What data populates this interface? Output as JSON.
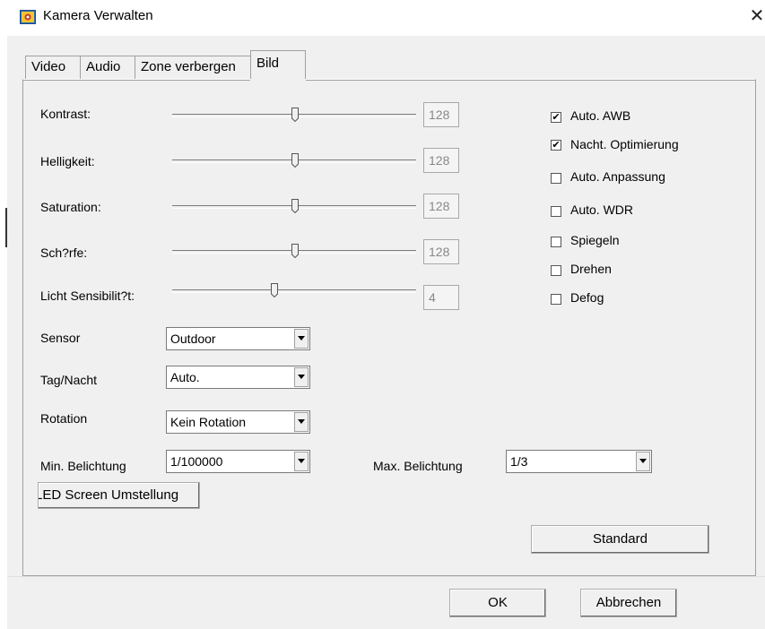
{
  "window": {
    "title": "Kamera Verwalten",
    "icon": "camera-app-icon",
    "close_glyph": "✕"
  },
  "tabs": [
    {
      "label": "Video",
      "active": false
    },
    {
      "label": "Audio",
      "active": false
    },
    {
      "label": "Zone verbergen",
      "active": false
    },
    {
      "label": "Bild",
      "active": true
    }
  ],
  "sliders": [
    {
      "label": "Kontrast:",
      "value": "128",
      "level": 128,
      "max": 255
    },
    {
      "label": "Helligkeit:",
      "value": "128",
      "level": 128,
      "max": 255
    },
    {
      "label": "Saturation:",
      "value": "128",
      "level": 128,
      "max": 255
    },
    {
      "label": "Sch?rfe:",
      "value": "128",
      "level": 128,
      "max": 255
    },
    {
      "label": "Licht Sensibilit?t:",
      "value": "4",
      "level": 4,
      "max": 8
    }
  ],
  "checkboxes": [
    {
      "label": "Auto. AWB",
      "checked": true
    },
    {
      "label": "Nacht. Optimierung",
      "checked": true
    },
    {
      "label": "Auto. Anpassung",
      "checked": false
    },
    {
      "label": "Auto. WDR",
      "checked": false
    },
    {
      "label": "Spiegeln",
      "checked": false
    },
    {
      "label": "Drehen",
      "checked": false
    },
    {
      "label": "Defog",
      "checked": false
    }
  ],
  "check_glyph": "✔",
  "selects": {
    "sensor": {
      "label": "Sensor",
      "value": "Outdoor"
    },
    "tag_nacht": {
      "label": "Tag/Nacht",
      "value": "Auto."
    },
    "rotation": {
      "label": "Rotation",
      "value": "Kein Rotation"
    },
    "min_belichtung": {
      "label": "Min. Belichtung",
      "value": "1/100000"
    },
    "max_belichtung": {
      "label": "Max. Belichtung",
      "value": "1/3"
    }
  },
  "buttons": {
    "led_screen": "LED Screen Umstellung",
    "standard": "Standard",
    "ok": "OK",
    "cancel": "Abbrechen"
  }
}
